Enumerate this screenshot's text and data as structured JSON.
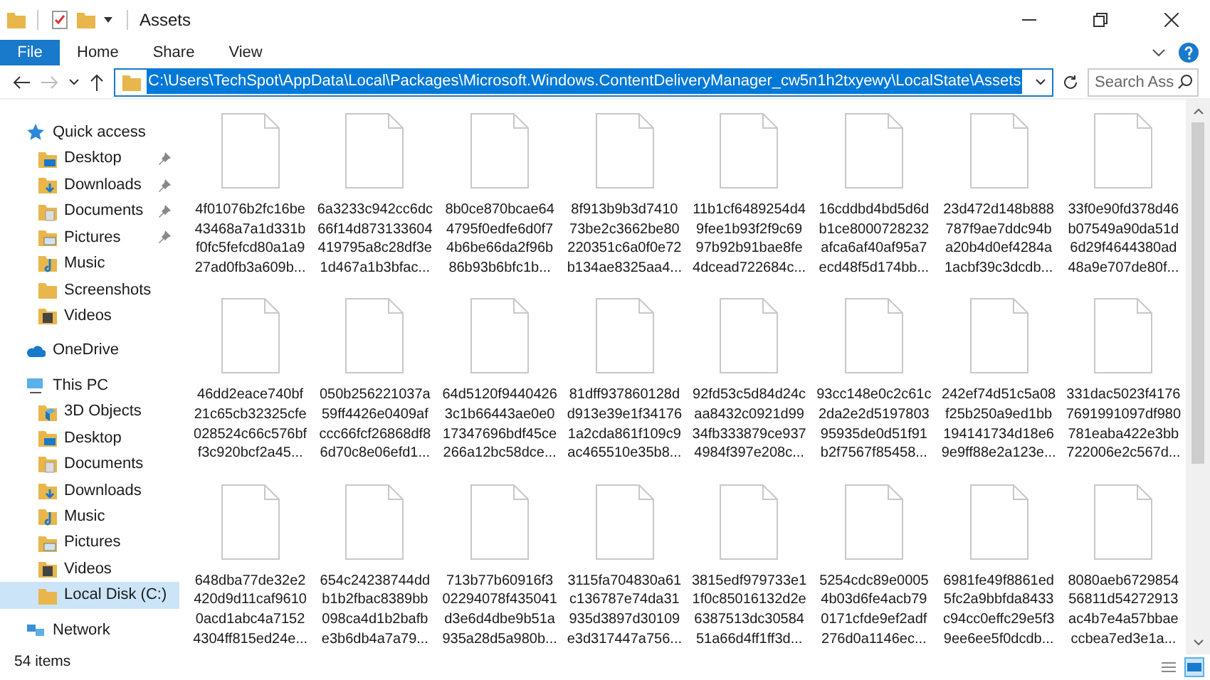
{
  "window": {
    "title": "Assets"
  },
  "ribbon_tabs": [
    {
      "label": "File",
      "selected": true
    },
    {
      "label": "Home",
      "selected": false
    },
    {
      "label": "Share",
      "selected": false
    },
    {
      "label": "View",
      "selected": false
    }
  ],
  "address": {
    "value": "C:\\Users\\TechSpot\\AppData\\Local\\Packages\\Microsoft.Windows.ContentDeliveryManager_cw5n1h2txyewy\\LocalState\\Assets"
  },
  "search": {
    "placeholder": "Search Ass"
  },
  "sidebar": {
    "items": [
      {
        "label": "Quick access",
        "kind": "quick",
        "selected": false,
        "children": [
          {
            "label": "Desktop",
            "kind": "desktop",
            "pinned": true,
            "selected": false
          },
          {
            "label": "Downloads",
            "kind": "downloads",
            "pinned": true,
            "selected": false
          },
          {
            "label": "Documents",
            "kind": "documents",
            "pinned": true,
            "selected": false
          },
          {
            "label": "Pictures",
            "kind": "pictures",
            "pinned": true,
            "selected": false
          },
          {
            "label": "Music",
            "kind": "music",
            "pinned": false,
            "selected": false
          },
          {
            "label": "Screenshots",
            "kind": "folder",
            "pinned": false,
            "selected": false
          },
          {
            "label": "Videos",
            "kind": "videos",
            "pinned": false,
            "selected": false
          }
        ]
      },
      {
        "label": "OneDrive",
        "kind": "cloud",
        "selected": false
      },
      {
        "label": "This PC",
        "kind": "pc",
        "selected": false,
        "children": [
          {
            "label": "3D Objects",
            "kind": "objects",
            "pinned": false,
            "selected": false
          },
          {
            "label": "Desktop",
            "kind": "desktop",
            "pinned": false,
            "selected": false
          },
          {
            "label": "Documents",
            "kind": "documents",
            "pinned": false,
            "selected": false
          },
          {
            "label": "Downloads",
            "kind": "downloads",
            "pinned": false,
            "selected": false
          },
          {
            "label": "Music",
            "kind": "music",
            "pinned": false,
            "selected": false
          },
          {
            "label": "Pictures",
            "kind": "pictures",
            "pinned": false,
            "selected": false
          },
          {
            "label": "Videos",
            "kind": "videos",
            "pinned": false,
            "selected": false
          },
          {
            "label": "Local Disk (C:)",
            "kind": "disk",
            "pinned": false,
            "selected": true
          }
        ]
      },
      {
        "label": "Network",
        "kind": "network",
        "selected": false
      }
    ]
  },
  "files": [
    {
      "name_lines": [
        "4f01076b2fc16be",
        "43468a7a1d331b",
        "f0fc5fefcd80a1a9",
        "27ad0fb3a609b..."
      ]
    },
    {
      "name_lines": [
        "6a3233c942cc6dc",
        "66f14d873133604",
        "419795a8c28df3e",
        "1d467a1b3bfac..."
      ]
    },
    {
      "name_lines": [
        "8b0ce870bcae64",
        "4795f0edfe6d0f7",
        "4b6be66da2f96b",
        "86b93b6bfc1b..."
      ]
    },
    {
      "name_lines": [
        "8f913b9b3d7410",
        "73be2c3662be80",
        "220351c6a0f0e72",
        "b134ae8325aa4..."
      ]
    },
    {
      "name_lines": [
        "11b1cf6489254d4",
        "9fee1b93f2f9c69",
        "97b92b91bae8fe",
        "4dcead722684c..."
      ]
    },
    {
      "name_lines": [
        "16cddbd4bd5d6d",
        "b1ce8000728232",
        "afca6af40af95a7",
        "ecd48f5d174bb..."
      ]
    },
    {
      "name_lines": [
        "23d472d148b888",
        "787f9ae7ddc94b",
        "a20b4d0ef4284a",
        "1acbf39c3dcdb..."
      ]
    },
    {
      "name_lines": [
        "33f0e90fd378d46",
        "b07549a90da51d",
        "6d29f4644380ad",
        "48a9e707de80f..."
      ]
    },
    {
      "name_lines": [
        "46dd2eace740bf",
        "21c65cb32325cfe",
        "028524c66c576bf",
        "f3c920bcf2a45..."
      ]
    },
    {
      "name_lines": [
        "050b256221037a",
        "59ff4426e0409af",
        "ccc66fcf26868df8",
        "6d70c8e06efd1..."
      ]
    },
    {
      "name_lines": [
        "64d5120f9440426",
        "3c1b66443ae0e0",
        "17347696bdf45ce",
        "266a12bc58dce..."
      ]
    },
    {
      "name_lines": [
        "81dff937860128d",
        "d913e39e1f34176",
        "1a2cda861f109c9",
        "ac465510e35b8..."
      ]
    },
    {
      "name_lines": [
        "92fd53c5d84d24c",
        "aa8432c0921d99",
        "34fb333879ce937",
        "4984f397e208c..."
      ]
    },
    {
      "name_lines": [
        "93cc148e0c2c61c",
        "2da2e2d5197803",
        "95935de0d51f91",
        "b2f7567f85458..."
      ]
    },
    {
      "name_lines": [
        "242ef74d51c5a08",
        "f25b250a9ed1bb",
        "194141734d18e6",
        "9e9ff88e2a123e..."
      ]
    },
    {
      "name_lines": [
        "331dac5023f4176",
        "7691991097df980",
        "781eaba422e3bb",
        "722006e2c567d..."
      ]
    },
    {
      "name_lines": [
        "648dba77de32e2",
        "420d9d11caf9610",
        "0acd1abc4a7152",
        "4304ff815ed24e..."
      ]
    },
    {
      "name_lines": [
        "654c24238744dd",
        "b1b2fbac8389bb",
        "098ca4d1b2bafb",
        "e3b6db4a7a79..."
      ]
    },
    {
      "name_lines": [
        "713b77b60916f3",
        "02294078f435041",
        "d3e6d4dbe9b51a",
        "935a28d5a980b..."
      ]
    },
    {
      "name_lines": [
        "3115fa704830a61",
        "c136787e74da31",
        "935d3897d30109",
        "e3d317447a756..."
      ]
    },
    {
      "name_lines": [
        "3815edf979733e1",
        "1f0c85016132d2e",
        "6387513dc30584",
        "51a66d4ff1ff3d..."
      ]
    },
    {
      "name_lines": [
        "5254cdc89e0005",
        "4b03d6fe4acb79",
        "0171cfde9ef2adf",
        "276d0a1146ec..."
      ]
    },
    {
      "name_lines": [
        "6981fe49f8861ed",
        "5fc2a9bbfda8433",
        "c94cc0effc29e5f3",
        "9ee6ee5f0dcdb..."
      ]
    },
    {
      "name_lines": [
        "8080aeb6729854",
        "56811d54272913",
        "ac4b7e4a57bbae",
        "ccbea7ed3e1a..."
      ]
    }
  ],
  "status_bar": {
    "count": "54 items"
  },
  "view_mode": {
    "details": false,
    "large_icons": true
  }
}
